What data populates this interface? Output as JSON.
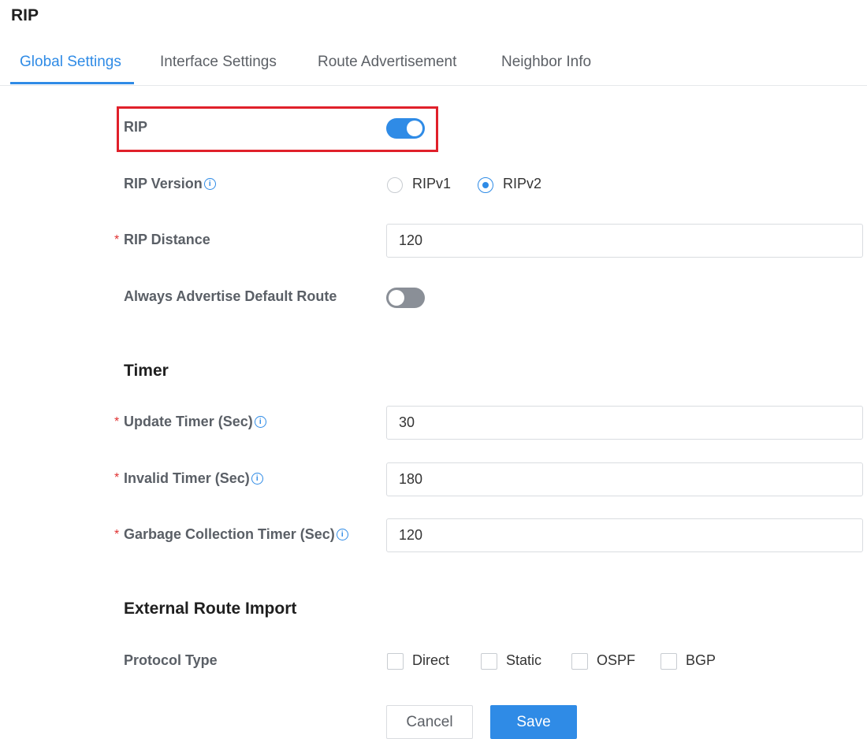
{
  "page": {
    "title": "RIP"
  },
  "tabs": [
    {
      "label": "Global Settings",
      "active": true
    },
    {
      "label": "Interface Settings",
      "active": false
    },
    {
      "label": "Route Advertisement",
      "active": false
    },
    {
      "label": "Neighbor Info",
      "active": false
    }
  ],
  "form": {
    "rip": {
      "label": "RIP",
      "enabled": true
    },
    "rip_version": {
      "label": "RIP Version",
      "options": [
        "RIPv1",
        "RIPv2"
      ],
      "selected": "RIPv2"
    },
    "rip_distance": {
      "label": "RIP Distance",
      "value": "120",
      "required": "*"
    },
    "always_advertise": {
      "label": "Always Advertise Default Route",
      "enabled": false
    },
    "timer": {
      "title": "Timer",
      "update": {
        "label": "Update Timer (Sec)",
        "value": "30",
        "required": "*"
      },
      "invalid": {
        "label": "Invalid Timer (Sec)",
        "value": "180",
        "required": "*"
      },
      "garbage": {
        "label": "Garbage Collection Timer (Sec)",
        "value": "120",
        "required": "*"
      }
    },
    "external": {
      "title": "External Route Import",
      "protocol_label": "Protocol Type",
      "protocols": [
        "Direct",
        "Static",
        "OSPF",
        "BGP"
      ]
    }
  },
  "actions": {
    "cancel": "Cancel",
    "save": "Save"
  },
  "colors": {
    "accent": "#2f8be6",
    "highlight": "#e0202a",
    "required": "#e03131"
  },
  "icons": {
    "info": "info-icon"
  }
}
